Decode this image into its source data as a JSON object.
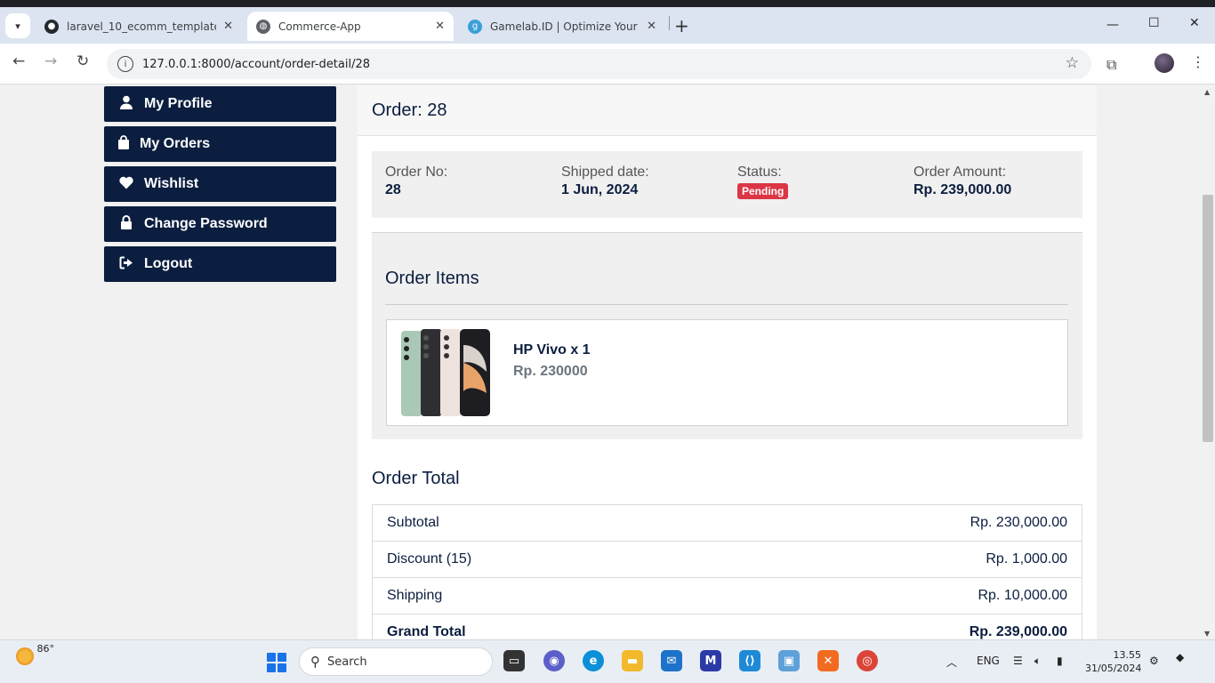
{
  "browser": {
    "tabs": [
      {
        "title": "laravel_10_ecomm_templates/p",
        "icon": "github-icon"
      },
      {
        "title": "Commerce-App",
        "icon": "globe-icon"
      },
      {
        "title": "Gamelab.ID | Optimize Your Dig",
        "icon": "gamelab-icon"
      }
    ],
    "url": "127.0.0.1:8000/account/order-detail/28"
  },
  "sidebar": {
    "items": [
      {
        "label": "My Profile",
        "icon": "user-icon"
      },
      {
        "label": "My Orders",
        "icon": "shopping-bag-icon"
      },
      {
        "label": "Wishlist",
        "icon": "heart-icon"
      },
      {
        "label": "Change Password",
        "icon": "lock-icon"
      },
      {
        "label": "Logout",
        "icon": "logout-icon"
      }
    ]
  },
  "order": {
    "header": "Order: 28",
    "summary": {
      "order_no_label": "Order No:",
      "order_no": "28",
      "shipped_label": "Shipped date:",
      "shipped_date": "1 Jun, 2024",
      "status_label": "Status:",
      "status": "Pending",
      "amount_label": "Order Amount:",
      "amount": "Rp. 239,000.00"
    },
    "items_heading": "Order Items",
    "items": [
      {
        "name": "HP Vivo x 1",
        "price": "Rp. 230000"
      }
    ],
    "total_heading": "Order Total",
    "totals": [
      {
        "label": "Subtotal",
        "value": "Rp. 230,000.00"
      },
      {
        "label": "Discount (15)",
        "value": "Rp. 1,000.00"
      },
      {
        "label": "Shipping",
        "value": "Rp. 10,000.00"
      },
      {
        "label": "Grand Total",
        "value": "Rp. 239,000.00"
      }
    ]
  },
  "taskbar": {
    "weather": "86°",
    "search_placeholder": "Search",
    "lang": "ENG",
    "time": "13.55",
    "date": "31/05/2024"
  },
  "colors": {
    "navy": "#0b1e3f",
    "badge_red": "#dc3545"
  }
}
